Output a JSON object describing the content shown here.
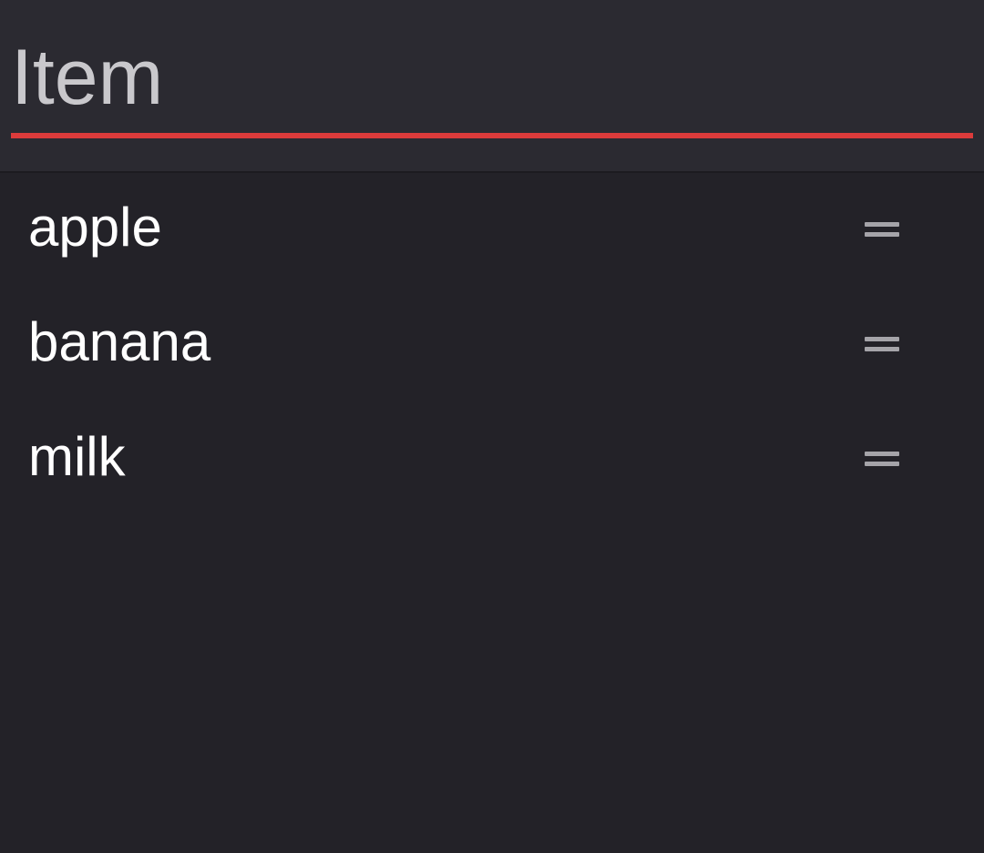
{
  "input": {
    "value": "",
    "placeholder": "Item",
    "accent_color": "#dc3b3b"
  },
  "list": {
    "items": [
      {
        "label": "apple",
        "handle_icon": "drag-handle-icon"
      },
      {
        "label": "banana",
        "handle_icon": "drag-handle-icon"
      },
      {
        "label": "milk",
        "handle_icon": "drag-handle-icon"
      }
    ]
  },
  "colors": {
    "background": "#232228",
    "input_background": "#2b2a31",
    "text": "#ffffff",
    "placeholder": "#c9c8cc",
    "handle": "#a5a4a9"
  }
}
